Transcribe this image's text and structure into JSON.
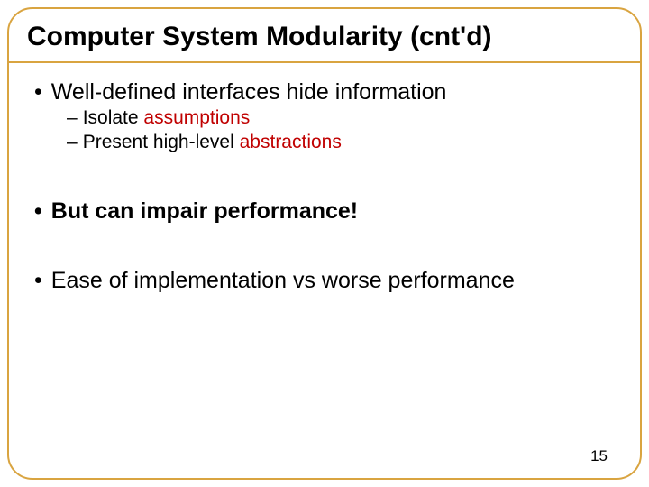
{
  "title": "Computer System Modularity (cnt'd)",
  "bullets": {
    "b1": "Well-defined interfaces hide information",
    "b1a_pre": "Isolate ",
    "b1a_red": "assumptions",
    "b1b_pre": "Present high-level ",
    "b1b_red": "abstractions",
    "b2": "But can impair performance!",
    "b3": "Ease of implementation vs worse performance"
  },
  "page_number": "15"
}
